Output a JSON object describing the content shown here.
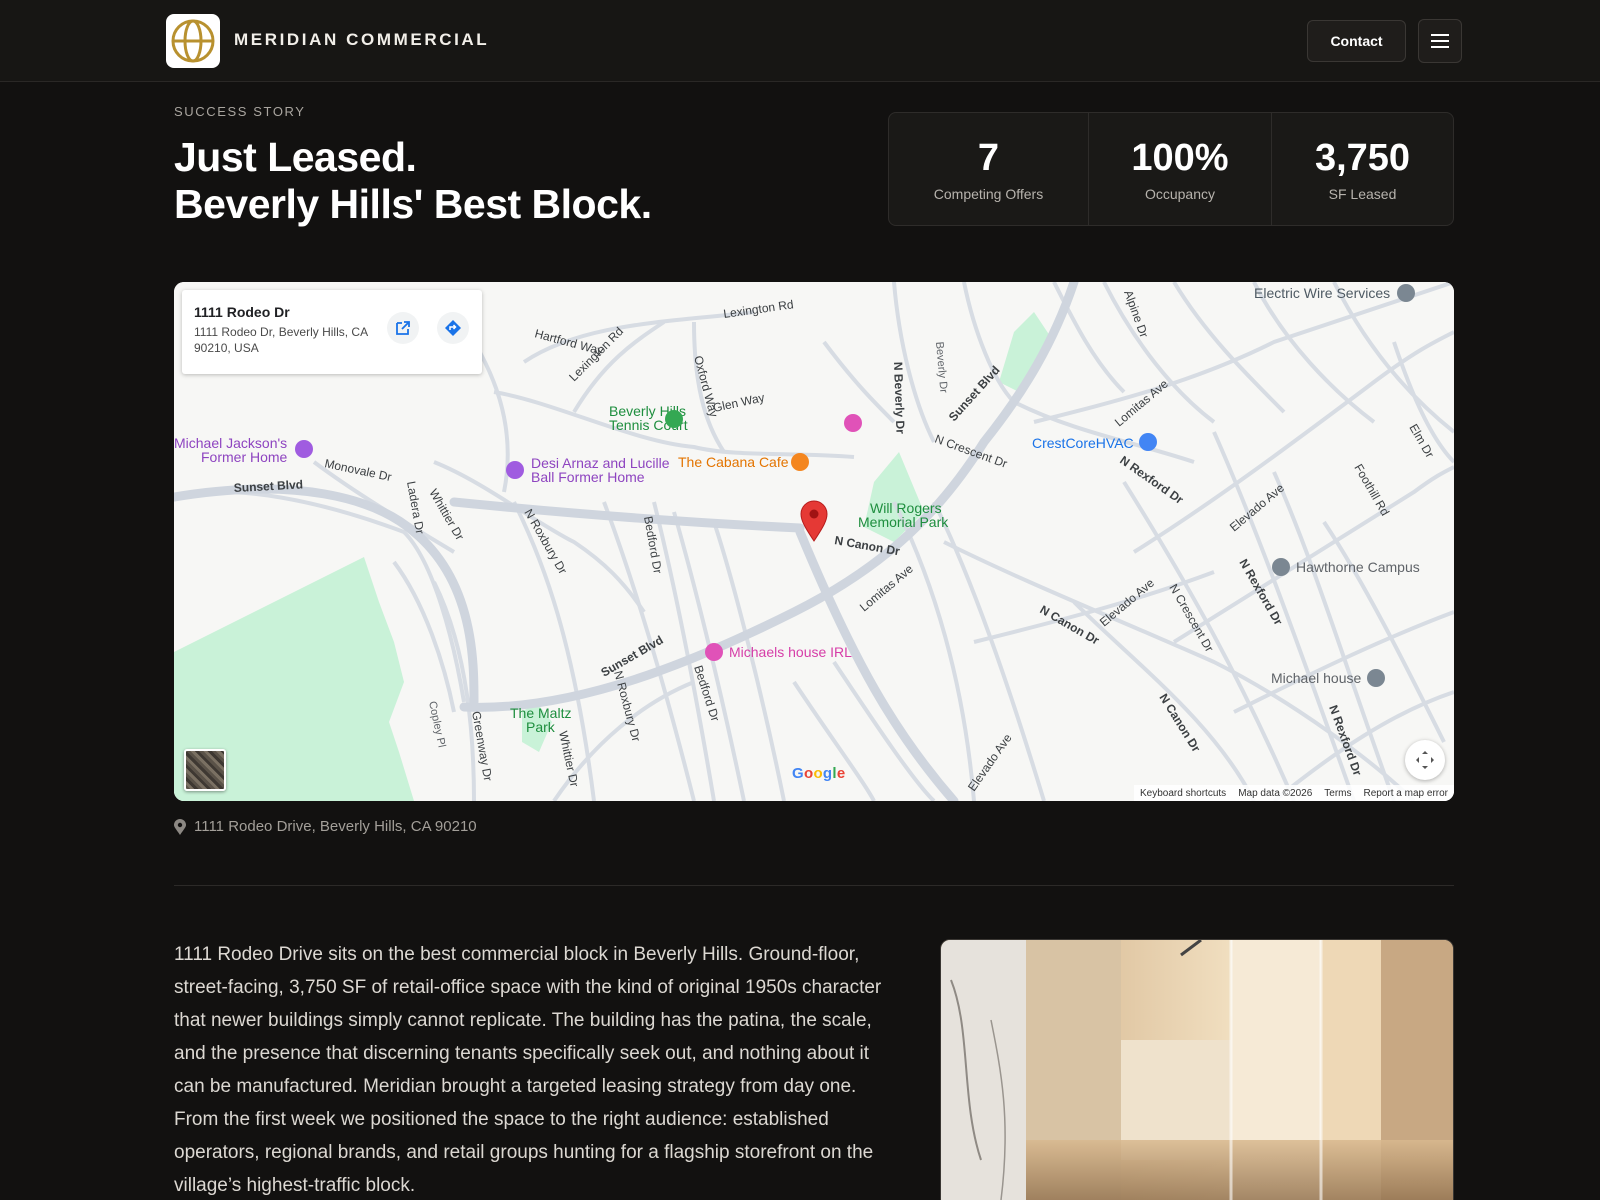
{
  "header": {
    "brand": "MERIDIAN COMMERCIAL",
    "contact_label": "Contact",
    "logo_icon": "globe-icon",
    "menu_icon": "hamburger-menu-icon",
    "accent_color": "#b8912f"
  },
  "hero": {
    "eyebrow": "SUCCESS STORY",
    "title_line1": "Just Leased.",
    "title_line2": "Beverly Hills' Best Block."
  },
  "stats": [
    {
      "value": "7",
      "label": "Competing Offers"
    },
    {
      "value": "100%",
      "label": "Occupancy"
    },
    {
      "value": "3,750",
      "label": "SF Leased"
    }
  ],
  "map": {
    "card_title": "1111 Rodeo Dr",
    "card_address": "1111 Rodeo Dr, Beverly Hills, CA 90210, USA",
    "open_icon": "open-external-icon",
    "directions_icon": "directions-icon",
    "google_logo": "Google",
    "footer": {
      "shortcuts": "Keyboard shortcuts",
      "data": "Map data ©2026",
      "terms": "Terms",
      "report": "Report a map error"
    },
    "labels": {
      "electric": "Electric Wire Services",
      "tennis1": "Beverly Hills",
      "tennis2": "Tennis Court",
      "jackson1": "Michael Jackson's",
      "jackson2": "Former Home",
      "desi1": "Desi Arnaz and Lucille",
      "desi2": "Ball Former Home",
      "cabana": "The Cabana Cafe",
      "crestcore": "CrestCoreHVAC",
      "willrogers1": "Will Rogers",
      "willrogers2": "Memorial Park",
      "hawthorne": "Hawthorne Campus",
      "michaels_irl": "Michaels house IRL",
      "michael_house": "Michael house",
      "maltz1": "The Maltz",
      "maltz2": "Park"
    },
    "streets": {
      "lexington": "Lexington Rd",
      "lexington2": "Lexington Rd",
      "hartford": "Hartford Way",
      "glen": "Glen Way",
      "oxford": "Oxford Way",
      "sunset1": "Sunset Blvd",
      "sunset2": "Sunset Blvd",
      "sunset3": "Sunset Blvd",
      "monovale": "Monovale Dr",
      "ladera": "Ladera Dr",
      "whittier": "Whittier Dr",
      "whittier2": "Whittier Dr",
      "nroxbury": "N Roxbury Dr",
      "nroxbury2": "N Roxbury Dr",
      "bedford": "Bedford Dr",
      "bedford2": "Bedford Dr",
      "nbeverly": "N Beverly Dr",
      "ncrescent": "N Crescent Dr",
      "ncrescent2": "N Crescent Dr",
      "ncanon": "N Canon Dr",
      "ncanon2": "N Canon Dr",
      "ncanon3": "N Canon Dr",
      "lomitas": "Lomitas Ave",
      "lomitas2": "Lomitas Ave",
      "nrexford": "N Rexford Dr",
      "nrexford2": "N Rexford Dr",
      "nrexford3": "N Rexford Dr",
      "elevado": "Elevado Ave",
      "elevado2": "Elevado Ave",
      "elevado3": "Elevado Ave",
      "foothill": "Foothill Rd",
      "elm": "Elm Dr",
      "copley": "Copley Pl",
      "greenway": "Greenway Dr",
      "beverly_small": "Beverly Dr",
      "alpine": "Alpine Dr"
    }
  },
  "address_line": "1111 Rodeo Drive, Beverly Hills, CA 90210",
  "body_text": "1111 Rodeo Drive sits on the best commercial block in Beverly Hills. Ground-floor, street-facing, 3,750 SF of retail-office space with the kind of original 1950s character that newer buildings simply cannot replicate. The building has the patina, the scale, and the presence that discerning tenants specifically seek out, and nothing about it can be manufactured. Meridian brought a targeted leasing strategy from day one. From the first week we positioned the space to the right audience: established operators, regional brands, and retail groups hunting for a flagship storefront on the village’s highest-traffic block."
}
